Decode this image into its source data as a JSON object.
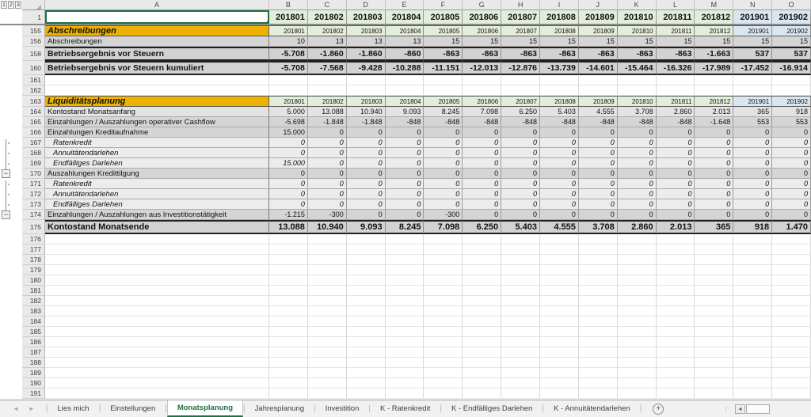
{
  "colors": {
    "accent_green_tab": "#1E7145",
    "selection_border": "#1E7145",
    "title_orange": "#EDB100",
    "year_green": "#E3EEDA",
    "year_blue": "#D9E6F2",
    "row_gray": "#D5D5D5",
    "total_gray": "#D2D2D2"
  },
  "outline_levels": [
    "1",
    "2",
    "3"
  ],
  "columns": [
    "A",
    "B",
    "C",
    "D",
    "E",
    "F",
    "G",
    "H",
    "I",
    "J",
    "K",
    "L",
    "M",
    "N",
    "O"
  ],
  "rows": [
    {
      "num": "1",
      "kind": "year",
      "label": "",
      "values": [
        "201801",
        "201802",
        "201803",
        "201804",
        "201805",
        "201806",
        "201807",
        "201808",
        "201809",
        "201810",
        "201811",
        "201812",
        "201901",
        "201902"
      ]
    },
    {
      "num": "155",
      "kind": "title",
      "label": "Abschreibungen",
      "values": [
        "201801",
        "201802",
        "201803",
        "201804",
        "201805",
        "201806",
        "201807",
        "201808",
        "201809",
        "201810",
        "201811",
        "201812",
        "201901",
        "201902"
      ]
    },
    {
      "num": "156",
      "kind": "gray",
      "label": "Abschreibungen",
      "values": [
        "10",
        "13",
        "13",
        "13",
        "15",
        "15",
        "15",
        "15",
        "15",
        "15",
        "15",
        "15",
        "15",
        "15"
      ]
    },
    {
      "num": "158",
      "kind": "totalsm",
      "label": "Betriebsergebnis vor Steuern",
      "values": [
        "-5.708",
        "-1.860",
        "-1.860",
        "-860",
        "-863",
        "-863",
        "-863",
        "-863",
        "-863",
        "-863",
        "-863",
        "-1.663",
        "537",
        "537"
      ]
    },
    {
      "num": "160",
      "kind": "totalsm",
      "label": "Betriebsergebnis vor Steuern kumuliert",
      "values": [
        "-5.708",
        "-7.568",
        "-9.428",
        "-10.288",
        "-11.151",
        "-12.013",
        "-12.876",
        "-13.739",
        "-14.601",
        "-15.464",
        "-16.326",
        "-17.989",
        "-17.452",
        "-16.914"
      ]
    },
    {
      "num": "161",
      "kind": "blank"
    },
    {
      "num": "162",
      "kind": "blank"
    },
    {
      "num": "163",
      "kind": "title",
      "label": "Liquiditätsplanung",
      "values": [
        "201801",
        "201802",
        "201803",
        "201804",
        "201805",
        "201806",
        "201807",
        "201808",
        "201809",
        "201810",
        "201811",
        "201812",
        "201901",
        "201902"
      ]
    },
    {
      "num": "164",
      "kind": "light",
      "label": "Kontostand Monatsanfang",
      "values": [
        "5.000",
        "13.088",
        "10.940",
        "9.093",
        "8.245",
        "7.098",
        "6.250",
        "5.403",
        "4.555",
        "3.708",
        "2.860",
        "2.013",
        "365",
        "918"
      ]
    },
    {
      "num": "165",
      "kind": "gray",
      "label": "Einzahlungen / Auszahlungen operativer Cashflow",
      "values": [
        "-5.698",
        "-1.848",
        "-1.848",
        "-848",
        "-848",
        "-848",
        "-848",
        "-848",
        "-848",
        "-848",
        "-848",
        "-1.648",
        "553",
        "553"
      ]
    },
    {
      "num": "166",
      "kind": "gray",
      "label": "Einzahlungen Kreditaufnahme",
      "values": [
        "15.000",
        "0",
        "0",
        "0",
        "0",
        "0",
        "0",
        "0",
        "0",
        "0",
        "0",
        "0",
        "0",
        "0"
      ]
    },
    {
      "num": "167",
      "kind": "sub",
      "outline": "dot-start",
      "label": "Ratenkredit",
      "values": [
        "0",
        "0",
        "0",
        "0",
        "0",
        "0",
        "0",
        "0",
        "0",
        "0",
        "0",
        "0",
        "0",
        "0"
      ]
    },
    {
      "num": "168",
      "kind": "sub",
      "outline": "dot",
      "label": "Annuitätendarlehen",
      "values": [
        "0",
        "0",
        "0",
        "0",
        "0",
        "0",
        "0",
        "0",
        "0",
        "0",
        "0",
        "0",
        "0",
        "0"
      ]
    },
    {
      "num": "169",
      "kind": "sub",
      "outline": "dot",
      "label": "Endfälliges Darlehen",
      "values": [
        "15.000",
        "0",
        "0",
        "0",
        "0",
        "0",
        "0",
        "0",
        "0",
        "0",
        "0",
        "0",
        "0",
        "0"
      ]
    },
    {
      "num": "170",
      "kind": "gray",
      "outline": "minus",
      "label": "Auszahlungen Kredittilgung",
      "values": [
        "0",
        "0",
        "0",
        "0",
        "0",
        "0",
        "0",
        "0",
        "0",
        "0",
        "0",
        "0",
        "0",
        "0"
      ]
    },
    {
      "num": "171",
      "kind": "sub",
      "outline": "dot-start",
      "label": "Ratenkredit",
      "values": [
        "0",
        "0",
        "0",
        "0",
        "0",
        "0",
        "0",
        "0",
        "0",
        "0",
        "0",
        "0",
        "0",
        "0"
      ]
    },
    {
      "num": "172",
      "kind": "sub",
      "outline": "dot",
      "label": "Annuitätendarlehen",
      "values": [
        "0",
        "0",
        "0",
        "0",
        "0",
        "0",
        "0",
        "0",
        "0",
        "0",
        "0",
        "0",
        "0",
        "0"
      ]
    },
    {
      "num": "173",
      "kind": "sub",
      "outline": "dot",
      "label": "Endfälliges Darlehen",
      "values": [
        "0",
        "0",
        "0",
        "0",
        "0",
        "0",
        "0",
        "0",
        "0",
        "0",
        "0",
        "0",
        "0",
        "0"
      ]
    },
    {
      "num": "174",
      "kind": "gray",
      "outline": "minus",
      "label": "Einzahlungen / Auszahlungen aus Investitionstätigkeit",
      "values": [
        "-1.215",
        "-300",
        "0",
        "0",
        "-300",
        "0",
        "0",
        "0",
        "0",
        "0",
        "0",
        "0",
        "0",
        "0"
      ]
    },
    {
      "num": "175",
      "kind": "total",
      "label": "Kontostand Monatsende",
      "values": [
        "13.088",
        "10.940",
        "9.093",
        "8.245",
        "7.098",
        "6.250",
        "5.403",
        "4.555",
        "3.708",
        "2.860",
        "2.013",
        "365",
        "918",
        "1.470"
      ]
    },
    {
      "num": "176",
      "kind": "blank"
    },
    {
      "num": "177",
      "kind": "blank"
    },
    {
      "num": "178",
      "kind": "blank"
    },
    {
      "num": "179",
      "kind": "blank"
    },
    {
      "num": "180",
      "kind": "blank"
    },
    {
      "num": "181",
      "kind": "blank"
    },
    {
      "num": "182",
      "kind": "blank"
    },
    {
      "num": "183",
      "kind": "blank"
    },
    {
      "num": "184",
      "kind": "blank"
    },
    {
      "num": "185",
      "kind": "blank"
    },
    {
      "num": "186",
      "kind": "blank"
    },
    {
      "num": "187",
      "kind": "blank"
    },
    {
      "num": "188",
      "kind": "blank"
    },
    {
      "num": "189",
      "kind": "blank"
    },
    {
      "num": "190",
      "kind": "blank"
    },
    {
      "num": "191",
      "kind": "blank"
    }
  ],
  "tab_bar": {
    "tabs": [
      {
        "label": "Lies mich",
        "active": false
      },
      {
        "label": "Einstellungen",
        "active": false
      },
      {
        "label": "Monatsplanung",
        "active": true
      },
      {
        "label": "Jahresplanung",
        "active": false
      },
      {
        "label": "Investition",
        "active": false
      },
      {
        "label": "K - Ratenkredit",
        "active": false
      },
      {
        "label": "K - Endfälliges Darlehen",
        "active": false
      },
      {
        "label": "K - Annuitätendarlehen",
        "active": false
      }
    ],
    "add_sheet_label": "+",
    "minus_glyph": "−",
    "nav_left": "◄",
    "nav_right": "►",
    "scroll_left_arrow": "◄",
    "dots": "⁞",
    "select_all_glyph": "◢"
  }
}
